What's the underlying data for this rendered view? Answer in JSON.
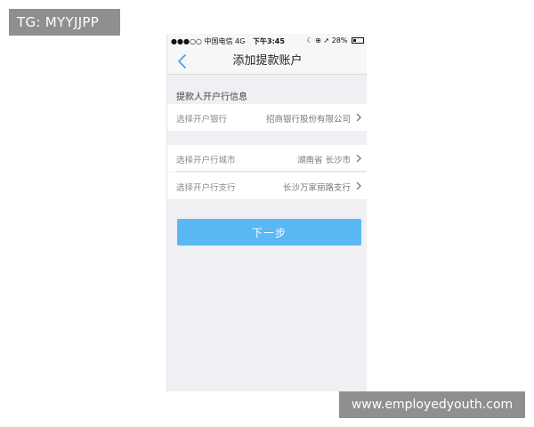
{
  "watermarks": {
    "top_left": "TG: MYYJJPP",
    "bottom_right": "www.employedyouth.com"
  },
  "status_bar": {
    "signal": "●●●○○",
    "carrier": "中国电信",
    "network": "4G",
    "time": "下午3:45",
    "icons": [
      "moon-icon",
      "orientation-lock-icon",
      "location-arrow-icon"
    ],
    "battery_percent": "28%",
    "battery_level": 0.28
  },
  "nav": {
    "back_icon": "chevron-left-icon",
    "title": "添加提款账户"
  },
  "section": {
    "header": "提款人开户行信息"
  },
  "rows": [
    {
      "label": "选择开户银行",
      "value": "招商银行股份有限公司"
    },
    {
      "label": "选择开户行城市",
      "value": "湖南省 长沙市"
    },
    {
      "label": "选择开户行支行",
      "value": "长沙万家丽路支行"
    }
  ],
  "next_button": {
    "label": "下一步",
    "color": "#5ab8f5"
  },
  "colors": {
    "background": "#efeff4",
    "accent": "#5ab8f5",
    "nav_back": "#4aa3e8"
  }
}
